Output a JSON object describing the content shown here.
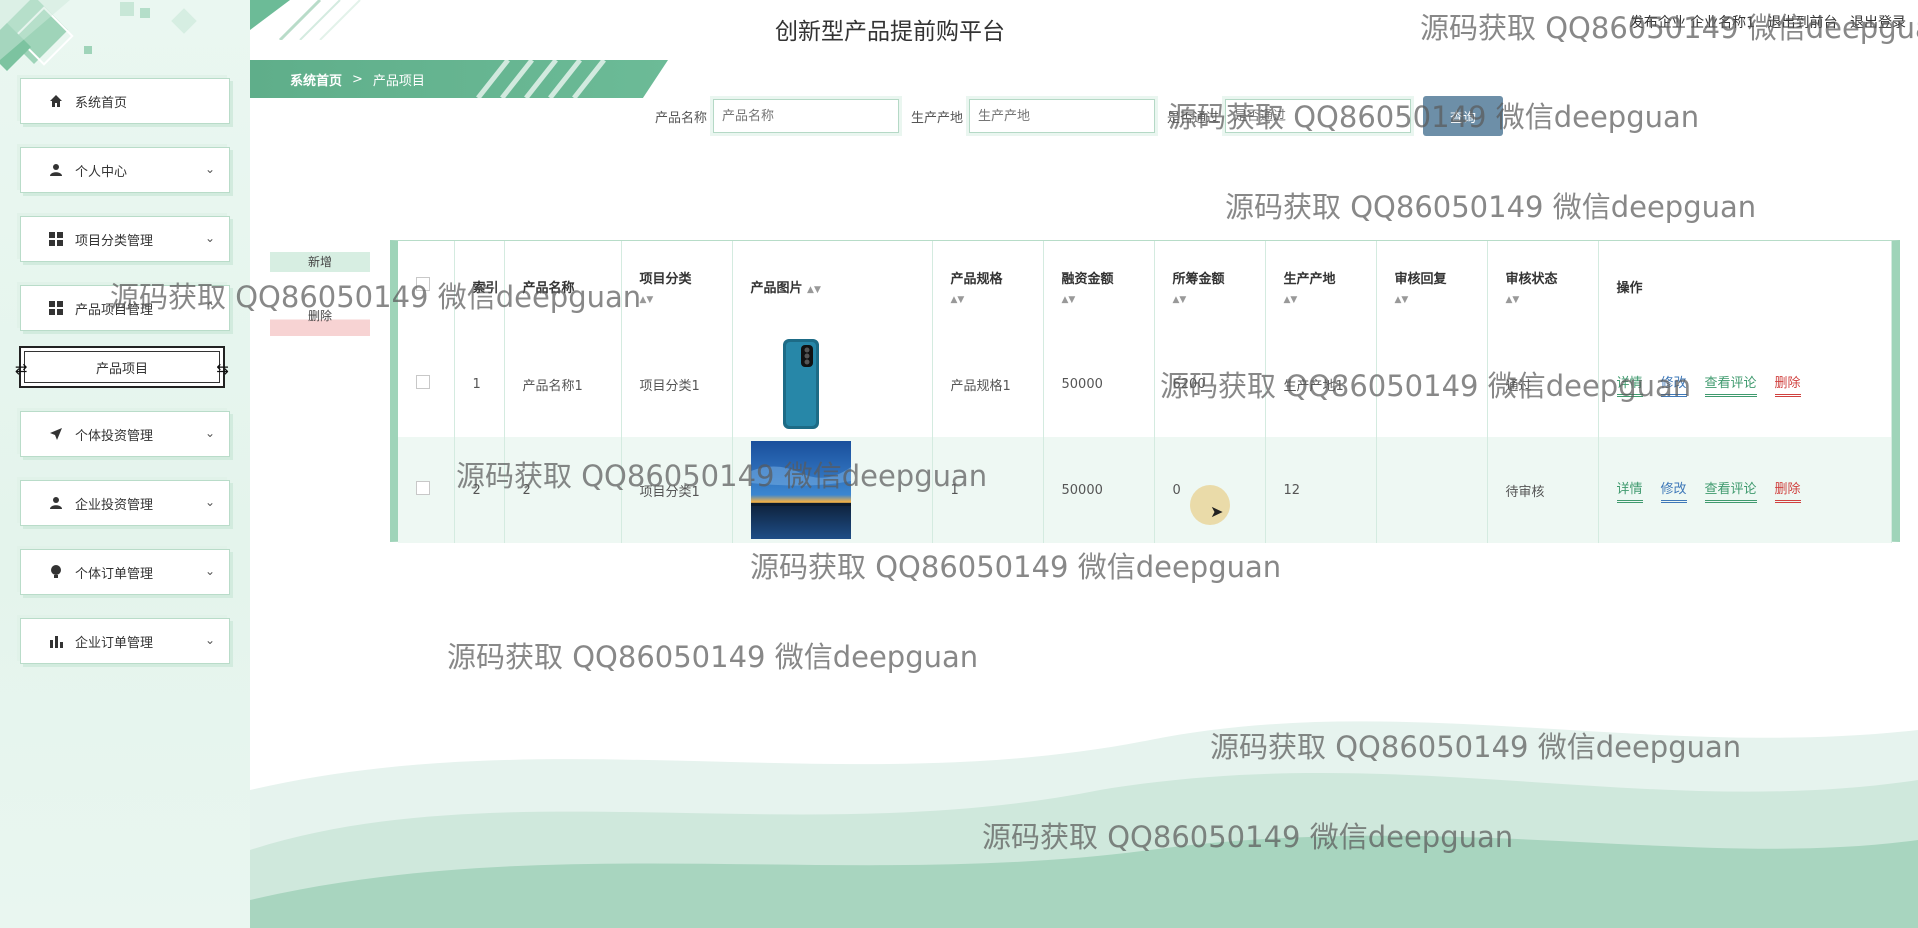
{
  "app": {
    "title": "创新型产品提前购平台",
    "user_info": "发布企业 企业名称1",
    "exit_front": "退出到前台",
    "logout": "退出登录"
  },
  "sidebar": {
    "items": [
      {
        "label": "系统首页",
        "icon": "home-icon",
        "expandable": false
      },
      {
        "label": "个人中心",
        "icon": "person-icon",
        "expandable": true
      },
      {
        "label": "项目分类管理",
        "icon": "grid-icon",
        "expandable": true
      },
      {
        "label": "产品项目管理",
        "icon": "grid-icon",
        "expandable": true
      },
      {
        "label": "产品项目",
        "icon": "",
        "expandable": false,
        "selected": true
      },
      {
        "label": "个体投资管理",
        "icon": "send-icon",
        "expandable": true
      },
      {
        "label": "企业投资管理",
        "icon": "person-icon",
        "expandable": true
      },
      {
        "label": "个体订单管理",
        "icon": "bulb-icon",
        "expandable": true
      },
      {
        "label": "企业订单管理",
        "icon": "bar-chart-icon",
        "expandable": true
      }
    ]
  },
  "breadcrumb": {
    "home": "系统首页",
    "separator": ">",
    "current": "产品项目"
  },
  "search": {
    "product_name_label": "产品名称",
    "product_name_placeholder": "产品名称",
    "origin_label": "生产产地",
    "origin_placeholder": "生产产地",
    "audit_label": "是否通过",
    "audit_placeholder": "是否通过",
    "button": "查询"
  },
  "actions": {
    "add": "新增",
    "delete": "删除"
  },
  "table": {
    "headers": [
      "索引",
      "产品名称",
      "项目分类",
      "产品图片",
      "产品规格",
      "融资金额",
      "所筹金额",
      "生产产地",
      "审核回复",
      "审核状态",
      "操作"
    ],
    "rows": [
      {
        "index": "1",
        "name": "产品名称1",
        "category": "项目分类1",
        "image": "phone",
        "spec": "产品规格1",
        "amount": "50000",
        "raised": "6200",
        "origin": "生产产地1",
        "reply": "",
        "status": "通过"
      },
      {
        "index": "2",
        "name": "2",
        "category": "项目分类1",
        "image": "sunset",
        "spec": "1",
        "amount": "50000",
        "raised": "0",
        "origin": "12",
        "reply": "",
        "status": "待审核"
      }
    ],
    "operations": {
      "detail": "详情",
      "edit": "修改",
      "comments": "查看评论",
      "delete": "删除"
    }
  },
  "colors": {
    "accent": "#6cbb97",
    "detail": "#3f9a6e",
    "edit": "#3e78b8",
    "comments": "#3f9a6e",
    "delete": "#d0413f"
  },
  "watermark": "源码获取 QQ86050149 微信deepguan"
}
